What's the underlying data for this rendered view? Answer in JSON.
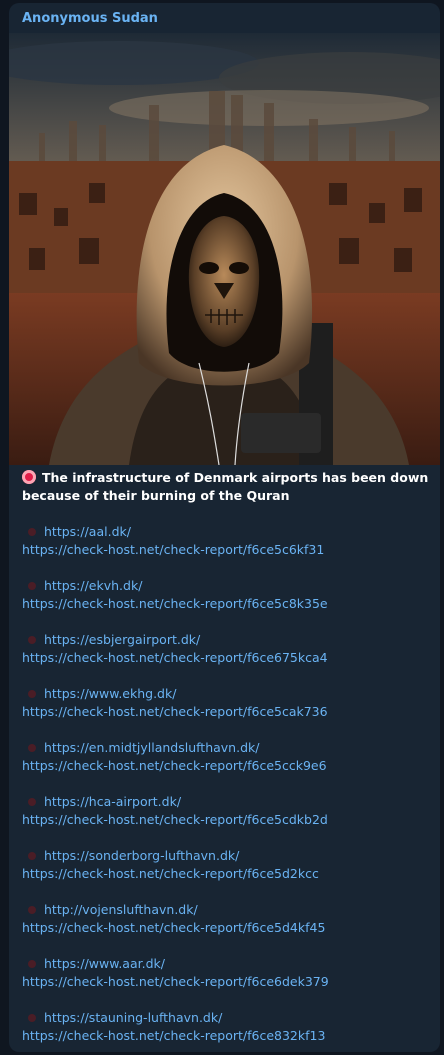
{
  "message": {
    "sender": "Anonymous Sudan",
    "headline": "The infrastructure of Denmark airports has been down because of their burning of the Quran",
    "entries": [
      {
        "site": "https://aal.dk/",
        "report": "https://check-host.net/check-report/f6ce5c6kf31"
      },
      {
        "site": "https://ekvh.dk/",
        "report": "https://check-host.net/check-report/f6ce5c8k35e"
      },
      {
        "site": "https://esbjergairport.dk/",
        "report": "https://check-host.net/check-report/f6ce675kca4"
      },
      {
        "site": "https://www.ekhg.dk/",
        "report": "https://check-host.net/check-report/f6ce5cak736"
      },
      {
        "site": "https://en.midtjyllandslufthavn.dk/",
        "report": "https://check-host.net/check-report/f6ce5cck9e6"
      },
      {
        "site": "https://hca-airport.dk/",
        "report": "https://check-host.net/check-report/f6ce5cdkb2d"
      },
      {
        "site": "https://sonderborg-lufthavn.dk/",
        "report": "https://check-host.net/check-report/f6ce5d2kcc"
      },
      {
        "site": "http://vojenslufthavn.dk/",
        "report": "https://check-host.net/check-report/f6ce5d4kf45"
      },
      {
        "site": "https://www.aar.dk/",
        "report": "https://check-host.net/check-report/f6ce6dek379"
      },
      {
        "site": "https://stauning-lufthavn.dk/",
        "report": "https://check-host.net/check-report/f6ce832kf13"
      }
    ]
  },
  "colors": {
    "background": "#0f1620",
    "bubble": "#182533",
    "sender": "#6ab3f3",
    "link": "#6ab3f3",
    "text": "#ffffff"
  },
  "icons": {
    "headline_badge": "red-circle-emoji-icon",
    "entry_bullet": "red-dot-icon"
  }
}
